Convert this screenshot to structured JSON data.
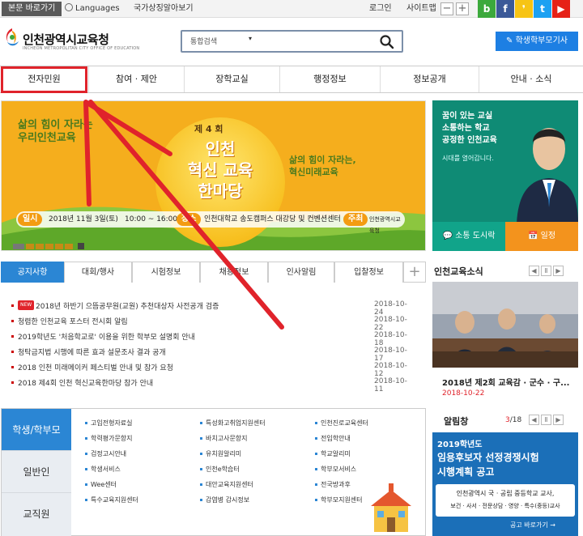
{
  "topbar": {
    "skip": "본문 바로가기",
    "languages": "Languages",
    "national": "국가상징알아보기",
    "login": "로그인",
    "sitemap": "사이트맵",
    "zoom_out": "−",
    "zoom_in": "+",
    "social": [
      {
        "icon": "blog-icon",
        "glyph": "b",
        "color": "#3ca93c"
      },
      {
        "icon": "facebook-icon",
        "glyph": "f",
        "color": "#3b5998"
      },
      {
        "icon": "kakaostory-icon",
        "glyph": "❜",
        "color": "#f7c414"
      },
      {
        "icon": "twitter-icon",
        "glyph": "t",
        "color": "#1da1f2"
      },
      {
        "icon": "youtube-icon",
        "glyph": "▶",
        "color": "#e62117"
      }
    ]
  },
  "header": {
    "logo_text": "인천광역시교육청",
    "logo_sub": "INCHEON METROPOLITAN CITY OFFICE OF EDUCATION",
    "search_category": "통합검색",
    "search_caret": "▾",
    "parent_button": "✎ 학생학부모기사"
  },
  "gnb": {
    "items": [
      "전자민원",
      "참여 · 제안",
      "장학교실",
      "행정정보",
      "정보공개",
      "안내 · 소식"
    ],
    "highlight_color": "#e0232b"
  },
  "hero": {
    "left_slogan_1": "삶의 힘이 자라는",
    "left_slogan_2": "우리인천교육",
    "ordinal": "제 4 회",
    "title_1": "인천",
    "title_2": "혁신 교육",
    "title_3": "한마당",
    "right_slogan_1": "삶의 힘이 자라는,",
    "right_slogan_2": "혁신미래교육",
    "tag_date": "일시",
    "date_text": "2018년 11월 3일(토)",
    "time_text": "10:00 ~ 16:00",
    "tag_place": "장소",
    "place_text": "인천대학교 송도캠퍼스 대강당 및 컨벤션센터",
    "tag_host": "주최",
    "host_text": "인천광역시교육청"
  },
  "superintendent": {
    "line1": "꿈이 있는 교실",
    "line2": "소통하는 학교",
    "line3": "공정한 인천교육",
    "sub": "시대를 열어갑니다.",
    "btn1": "💬 소통 도시락",
    "btn2": "📅 일정"
  },
  "notices": {
    "tabs": [
      "공지사항",
      "대회/행사",
      "시험정보",
      "채용정보",
      "인사알림",
      "입찰정보"
    ],
    "plus": "+",
    "new_badge": "NEW",
    "rows": [
      {
        "title": "2018년 하반기 으뜸공무원(교원) 추천대상자 사전공개 검증",
        "date": "2018-10-24",
        "new": true
      },
      {
        "title": "청렴한 인천교육 포스터 전시회 알림",
        "date": "2018-10-22",
        "new": false
      },
      {
        "title": "2019학년도 '처음학교로' 이용을 위한 학부모 설명회 안내",
        "date": "2018-10-18",
        "new": false
      },
      {
        "title": "청탁금지법 시행에 따른 효과 설문조사 결과 공개",
        "date": "2018-10-17",
        "new": false
      },
      {
        "title": "2018 인천 미래메이커 페스티벌 안내 및 참가 요청",
        "date": "2018-10-12",
        "new": false
      },
      {
        "title": "2018 제4회 인천 혁신교육한마당 참가 안내",
        "date": "2018-10-11",
        "new": false
      }
    ]
  },
  "news": {
    "title": "인천교육소식",
    "prev": "◀",
    "pause": "Ⅱ",
    "next": "▶",
    "caption": "2018년 제2회 교육감 · 군수 · 구...",
    "date": "2018-10-22"
  },
  "services": {
    "tabs": [
      "학생/학부모",
      "일반인",
      "교직원"
    ],
    "links": [
      "고입전형자료실",
      "특성화고취업지원센터",
      "인천진로교육센터",
      "학력평가문항지",
      "바치고사문항지",
      "전입학안내",
      "검정고시안내",
      "유치원알리미",
      "학교알리미",
      "학생서비스",
      "인천e학습터",
      "학부모서비스",
      "Wee센터",
      "대안교육지원센터",
      "전국방과후",
      "특수교육지원센터",
      "감염병 감시정보",
      "학부모지원센터"
    ]
  },
  "board": {
    "title": "알림창",
    "count_current": "3",
    "count_total": "/18",
    "prev": "◀",
    "pause": "Ⅱ",
    "next": "▶",
    "year": "2019학년도",
    "title_1": "임용후보자 선정경쟁시험",
    "title_2": "시행계획 공고",
    "line1": "인천광역시 국 · 공립 중등학교 교사,",
    "line2": "보건 · 사서 · 전문상담 · 영양 · 특수(중등)교사",
    "go": "공고 바로가기 →"
  }
}
